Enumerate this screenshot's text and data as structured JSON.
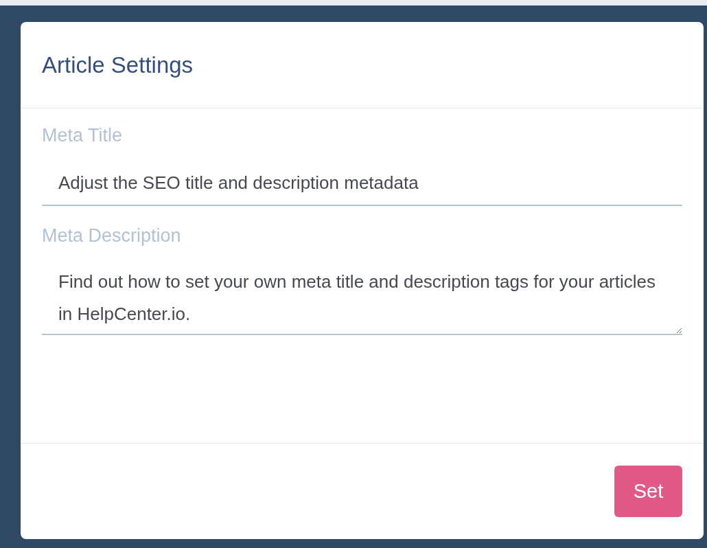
{
  "dialog": {
    "title": "Article Settings",
    "fields": [
      {
        "kind": "input",
        "label": "Meta Title",
        "value": "Adjust the SEO title and description metadata"
      },
      {
        "kind": "textarea",
        "label": "Meta Description",
        "value": "Find out how to set your own meta title and description tags for your articles in HelpCenter.io."
      }
    ],
    "buttons": [
      "Set"
    ]
  }
}
